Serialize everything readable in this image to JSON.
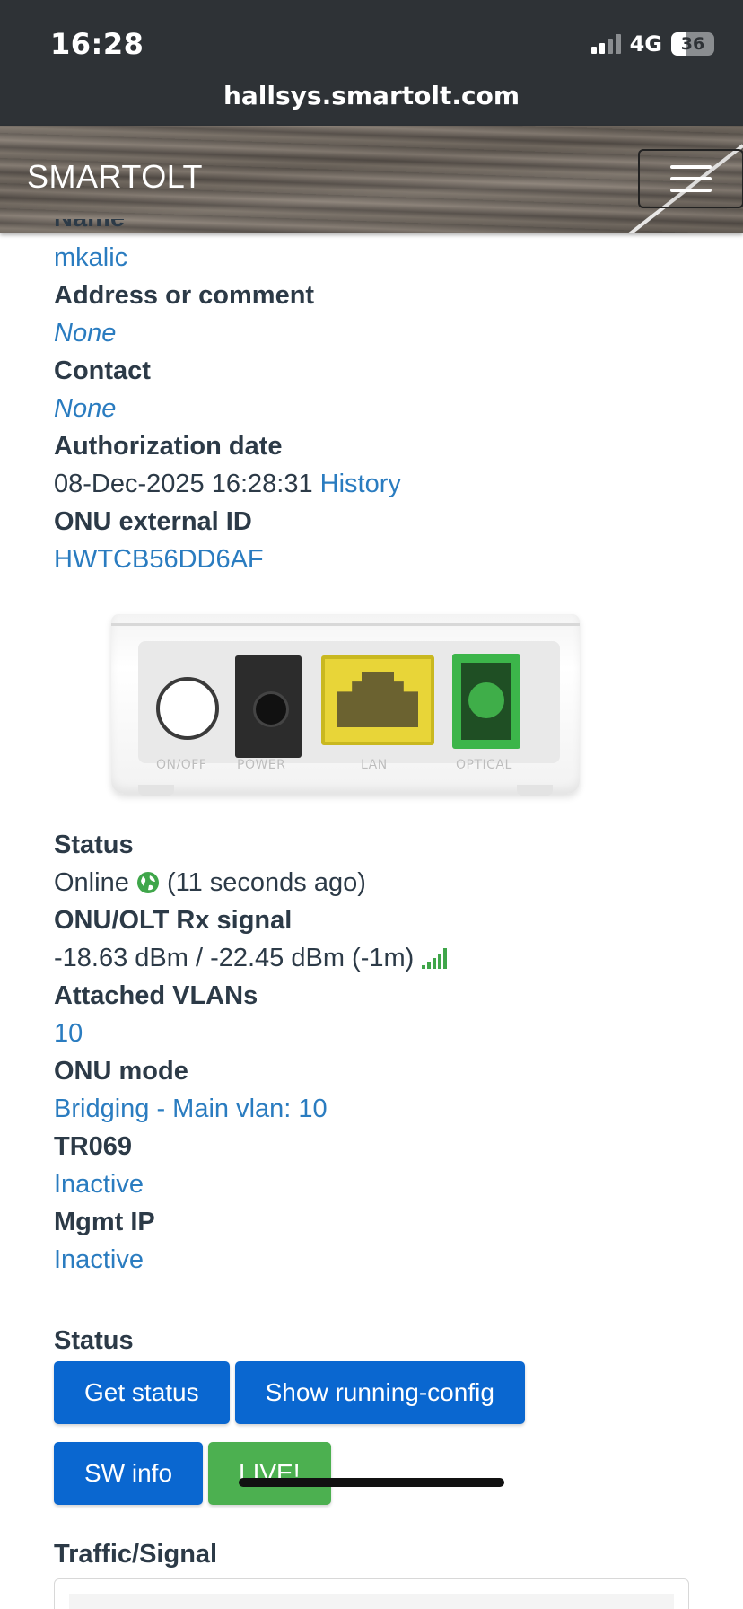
{
  "status_bar": {
    "time": "16:28",
    "network": "4G",
    "battery": "36",
    "signal_icon": "cellular-signal-icon"
  },
  "browser": {
    "url": "hallsys.smartolt.com"
  },
  "navbar": {
    "brand": "SMARTOLT",
    "menu_icon": "hamburger-menu-icon"
  },
  "details": {
    "name_label": "Name",
    "name_value": "mkalic",
    "address_label": "Address or comment",
    "address_value": "None",
    "contact_label": "Contact",
    "contact_value": "None",
    "auth_label": "Authorization date",
    "auth_value": "08-Dec-2025 16:28:31",
    "history_link": "History",
    "external_id_label": "ONU external ID",
    "external_id_value": "HWTCB56DD6AF"
  },
  "device_image": {
    "ports": [
      "ON/OFF",
      "POWER",
      "LAN",
      "OPTICAL"
    ]
  },
  "status": {
    "status_label": "Status",
    "status_value": "Online",
    "status_ago": "(11 seconds ago)",
    "rx_label": "ONU/OLT Rx signal",
    "rx_value": "-18.63 dBm / -22.45 dBm (-1m)",
    "vlans_label": "Attached VLANs",
    "vlans_value": "10",
    "mode_label": "ONU mode",
    "mode_value": "Bridging - Main vlan: 10",
    "tr069_label": "TR069",
    "tr069_value": "Inactive",
    "mgmt_label": "Mgmt IP",
    "mgmt_value": "Inactive"
  },
  "actions": {
    "section_title": "Status",
    "get_status": "Get status",
    "show_running_config": "Show running-config",
    "sw_info": "SW info",
    "live": "LIVE!"
  },
  "traffic": {
    "title": "Traffic/Signal"
  },
  "colors": {
    "link": "#2a7cc0",
    "button_blue": "#0a67d0",
    "button_green": "#4cb050",
    "online_green": "#3fa64a"
  }
}
